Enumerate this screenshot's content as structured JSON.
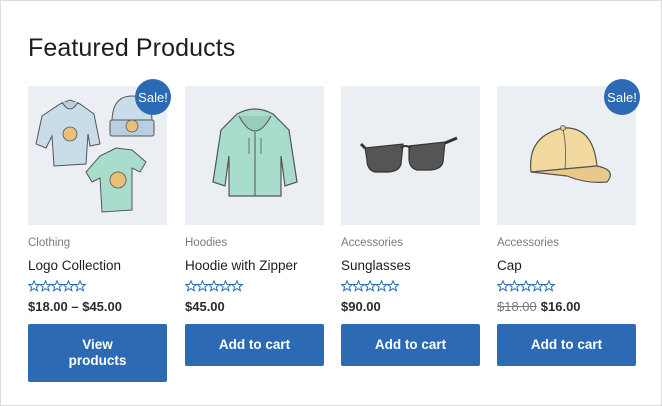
{
  "section": {
    "title": "Featured Products"
  },
  "products": [
    {
      "category": "Clothing",
      "name": "Logo Collection",
      "price": "$18.00 – $45.00",
      "sale_badge": "Sale!",
      "rating_stars": 0,
      "button": "View products",
      "image_icon": "clothing-set-icon"
    },
    {
      "category": "Hoodies",
      "name": "Hoodie with Zipper",
      "price": "$45.00",
      "rating_stars": 0,
      "button": "Add to cart",
      "image_icon": "hoodie-icon"
    },
    {
      "category": "Accessories",
      "name": "Sunglasses",
      "price": "$90.00",
      "rating_stars": 0,
      "button": "Add to cart",
      "image_icon": "sunglasses-icon"
    },
    {
      "category": "Accessories",
      "name": "Cap",
      "old_price": "$18.00",
      "price": "$16.00",
      "sale_badge": "Sale!",
      "rating_stars": 0,
      "button": "Add to cart",
      "image_icon": "cap-icon"
    }
  ],
  "colors": {
    "accent": "#2c6ab3",
    "image_bg": "#ebeef3",
    "muted_text": "#7b7b7b"
  }
}
